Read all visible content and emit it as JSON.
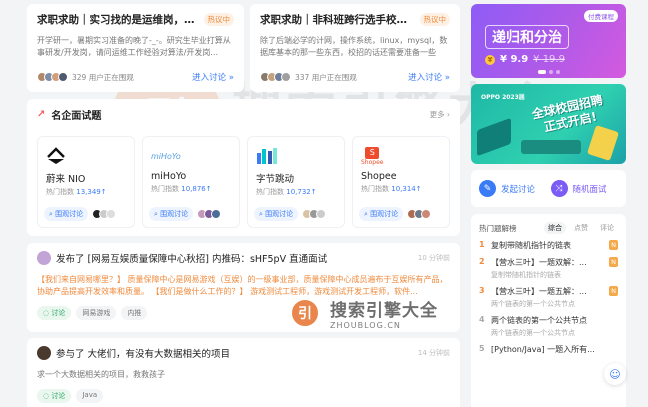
{
  "discussions": [
    {
      "title": "求职求助｜实习找的是运维岗，请问...",
      "badge": "热议中",
      "body": "开学研一，暑期实习准备的晚了-_-。研究生毕业打算从事研发/开发岗，请问运维工作经验对算法/开发岗...",
      "count_text": "329 用户正在围观",
      "join_label": "进入讨论 »"
    },
    {
      "title": "求职求助｜非科班跨行选手校招想拿...",
      "badge": "热议中",
      "body": "除了后端必学的计网，操作系统，linux，mysql，数据库基本的那一些东西，校招的话还需要准备一些微...",
      "count_text": "337 用户正在围观",
      "join_label": "进入讨论 »"
    }
  ],
  "companies_section": {
    "title": "名企面试题",
    "more_label": "更多 ›",
    "companies": [
      {
        "name": "蔚来 NIO",
        "logo_text": "NIO",
        "heat_label": "热门指数",
        "heat_value": "13,349↑",
        "button": "围观讨论",
        "accent": "#111111"
      },
      {
        "name": "miHoYo",
        "logo_text": "miHoYo",
        "heat_label": "热门指数",
        "heat_value": "10,876↑",
        "button": "围观讨论",
        "accent": "#5aa0e0"
      },
      {
        "name": "字节跳动",
        "logo_text": "",
        "heat_label": "热门指数",
        "heat_value": "10,732↑",
        "button": "围观讨论",
        "accent": "#3a7bf7"
      },
      {
        "name": "Shopee",
        "logo_text": "Shopee",
        "heat_label": "热门指数",
        "heat_value": "10,314↑",
        "button": "围观讨论",
        "accent": "#ee4d2d"
      }
    ]
  },
  "feed": [
    {
      "head": "发布了 [网易互娱质量保障中心秋招] 内推码：sHF5pV 直通面试",
      "time": "10 分钟前",
      "body": "【我们来自网易哪里？】 质量保障中心是网易游戏（互娱）的一级事业部，质量保障中心成员遍布于互娱所有产品，协助产品提高开发效率和质量。 【我们是做什么工作的？】 游戏测试工程师，游戏测试开发工程师，软件...",
      "tags": [
        "讨论",
        "网易游戏",
        "内推"
      ]
    },
    {
      "head": "参与了 大佬们，有没有大数据相关的项目",
      "time": "14 分钟前",
      "body": "求一个大数据相关的项目，救救孩子",
      "tags": [
        "讨论",
        "Java"
      ]
    }
  ],
  "promo": {
    "badge": "付费课程",
    "title": "递归和分治",
    "price": "¥ 9.9",
    "original_price": "¥ 19.9"
  },
  "banner": {
    "logo": "OPPO 2023届",
    "title_line1": "全球校园招聘",
    "title_line2": "正式开启!"
  },
  "actions": {
    "start": "发起讨论",
    "random": "随机面试"
  },
  "hot_list": {
    "title": "热门题解榜",
    "tabs": [
      "综合",
      "点赞",
      "评论"
    ],
    "items": [
      {
        "rank": "1",
        "title": "复制带随机指针的链表",
        "sub": "",
        "flag": "N"
      },
      {
        "rank": "2",
        "title": "【营水三叶】一题双解：...",
        "sub": "复制带随机指针的链表",
        "flag": "N"
      },
      {
        "rank": "3",
        "title": "【营水三叶】一题五解：...",
        "sub": "两个链表的第一个公共节点",
        "flag": "N"
      },
      {
        "rank": "4",
        "title": "两个链表的第一个公共节点",
        "sub": "两个链表的第一个公共节点",
        "flag": ""
      },
      {
        "rank": "5",
        "title": "[Python/Java] 一题入所有...",
        "sub": "",
        "flag": ""
      }
    ]
  },
  "watermark": {
    "brand": "搜索引擎大全",
    "domain": "ZHOUBLOG.CN",
    "icon_text": "引"
  },
  "colors": {
    "accent_blue": "#3a7bf7",
    "hot_orange": "#f08a3c",
    "discussion_green": "#2fa866"
  }
}
